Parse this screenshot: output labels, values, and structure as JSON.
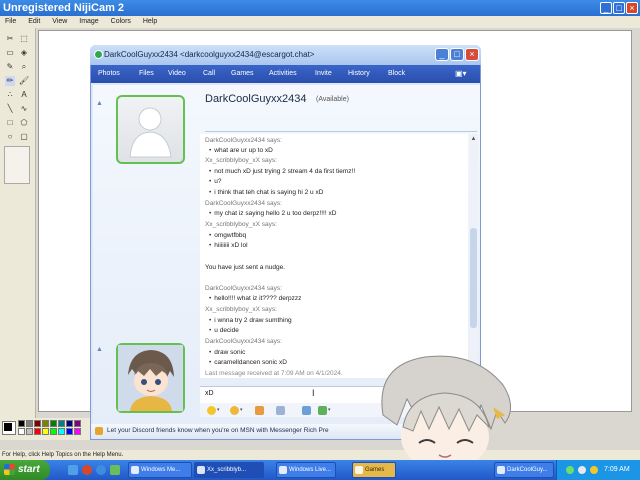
{
  "paint": {
    "title": "Unregistered NijiCam 2",
    "menu": [
      "File",
      "Edit",
      "View",
      "Image",
      "Colors",
      "Help"
    ],
    "status": "For Help, click Help Topics on the Help Menu.",
    "palette": [
      "#000000",
      "#808080",
      "#800000",
      "#808000",
      "#008000",
      "#008080",
      "#000080",
      "#800080",
      "#ffffff",
      "#c0c0c0",
      "#ff0000",
      "#ffff00",
      "#00ff00",
      "#00ffff",
      "#0000ff",
      "#ff00ff"
    ]
  },
  "chat": {
    "title": "DarkCoolGuyxx2434 <darkcoolguyxx2434@escargot.chat>",
    "menu": [
      "Photos",
      "Files",
      "Video",
      "Call",
      "Games",
      "Activities",
      "Invite",
      "History",
      "Block"
    ],
    "contact_name": "DarkCoolGuyxx2434",
    "contact_status": "(Available)",
    "messages": [
      {
        "sender": "DarkCoolGuyxx2434 says:",
        "lines": [
          "what are ur up to xD"
        ]
      },
      {
        "sender": "Xx_scribblyboy_xX says:",
        "lines": [
          "not much xD just trying 2 stream 4 da first tiemz!!",
          "u?",
          "i think that teh chat is saying hi 2 u xD"
        ]
      },
      {
        "sender": "DarkCoolGuyxx2434 says:",
        "lines": [
          "my chat iz saying hello 2 u too derpz!!!! xD"
        ]
      },
      {
        "sender": "Xx_scribblyboy_xX says:",
        "lines": [
          "omgwtfbbq",
          "hiiiiiiii xD lol"
        ]
      }
    ],
    "nudge": "You have just sent a nudge.",
    "messages2": [
      {
        "sender": "DarkCoolGuyxx2434 says:",
        "lines": [
          "hello!!!! what iz it???? derpzzz"
        ]
      },
      {
        "sender": "Xx_scribblyboy_xX says:",
        "lines": [
          "i wnna try 2 draw sumthing",
          "u decide"
        ]
      },
      {
        "sender": "DarkCoolGuyxx2434 says:",
        "lines": [
          "draw sonic",
          "caramelldancen sonic xD"
        ]
      }
    ],
    "last_received": "Last message received at 7:09 AM on 4/1/2024.",
    "input_text": "xD",
    "ad_text": "Let your Discord friends know when you're on MSN with Messenger Rich Pre"
  },
  "taskbar": {
    "start": "start",
    "tasks": [
      "Windows Me...",
      "Xx_scribblyb...",
      "Windows Live...",
      "Games",
      "DarkCoolGuy..."
    ],
    "clock": "7:09 AM"
  }
}
